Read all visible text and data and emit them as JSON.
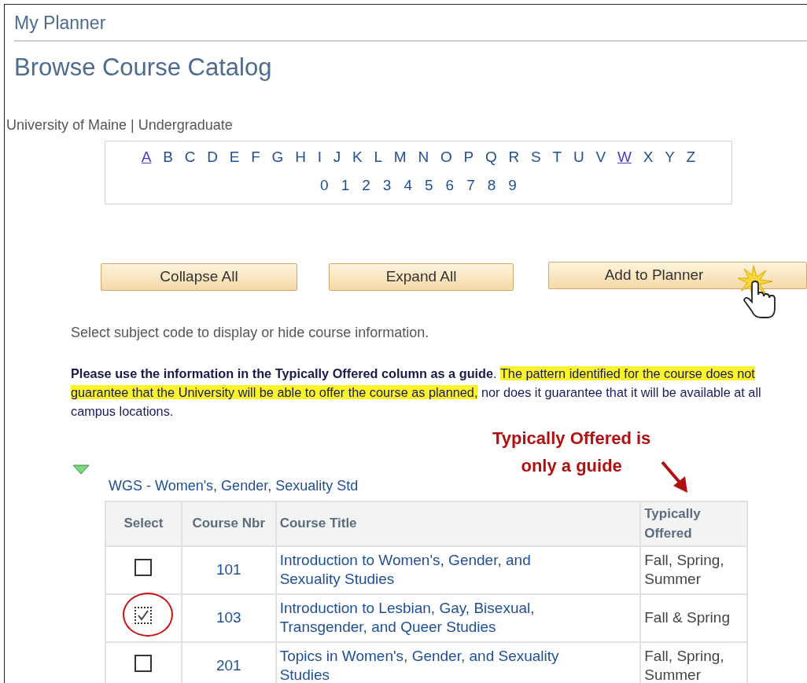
{
  "breadcrumb": "My Planner",
  "page_title": "Browse Course Catalog",
  "institution": "University of Maine | Undergraduate",
  "letters": [
    {
      "label": "A",
      "visited": true
    },
    {
      "label": "B",
      "visited": false
    },
    {
      "label": "C",
      "visited": false
    },
    {
      "label": "D",
      "visited": false
    },
    {
      "label": "E",
      "visited": false
    },
    {
      "label": "F",
      "visited": false
    },
    {
      "label": "G",
      "visited": false
    },
    {
      "label": "H",
      "visited": false
    },
    {
      "label": "I",
      "visited": false
    },
    {
      "label": "J",
      "visited": false
    },
    {
      "label": "K",
      "visited": false
    },
    {
      "label": "L",
      "visited": false
    },
    {
      "label": "M",
      "visited": false
    },
    {
      "label": "N",
      "visited": false
    },
    {
      "label": "O",
      "visited": false
    },
    {
      "label": "P",
      "visited": false
    },
    {
      "label": "Q",
      "visited": false
    },
    {
      "label": "R",
      "visited": false
    },
    {
      "label": "S",
      "visited": false
    },
    {
      "label": "T",
      "visited": false
    },
    {
      "label": "U",
      "visited": false
    },
    {
      "label": "V",
      "visited": false
    },
    {
      "label": "W",
      "visited": true
    },
    {
      "label": "X",
      "visited": false
    },
    {
      "label": "Y",
      "visited": false
    },
    {
      "label": "Z",
      "visited": false
    }
  ],
  "digits": [
    "0",
    "1",
    "2",
    "3",
    "4",
    "5",
    "6",
    "7",
    "8",
    "9"
  ],
  "buttons": [
    "Collapse All",
    "Expand All",
    "Add to Planner"
  ],
  "instruction": "Select subject code to display or hide course information.",
  "notice": [
    {
      "text": "**Please use the information in the Typically Offered column as a guide**. ",
      "highlight": false
    },
    {
      "text": "The pattern identified for the course does not guarantee that the University will be able to offer the course as planned,",
      "highlight": true
    },
    {
      "text": " nor does it guarantee that it will be available at all campus locations.",
      "highlight": false
    }
  ],
  "annotation": [
    "Typically Offered is",
    "only a guide"
  ],
  "subject": {
    "label": "WGS - Women's, Gender, Sexuality Std",
    "expanded": true
  },
  "table": {
    "columns": [
      "Select",
      "Course Nbr",
      "Course Title",
      "Typically Offered"
    ],
    "rows": [
      {
        "checked": false,
        "number": "101",
        "title": "Introduction to Women's, Gender, and Sexuality Studies",
        "offered": "Fall, Spring, Summer"
      },
      {
        "checked": true,
        "number": "103",
        "title": "Introduction to Lesbian, Gay, Bisexual, Transgender, and Queer Studies",
        "offered": "Fall & Spring"
      },
      {
        "checked": false,
        "number": "201",
        "title": "Topics in Women's, Gender, and Sexuality Studies",
        "offered": "Fall, Spring, Summer"
      }
    ]
  }
}
